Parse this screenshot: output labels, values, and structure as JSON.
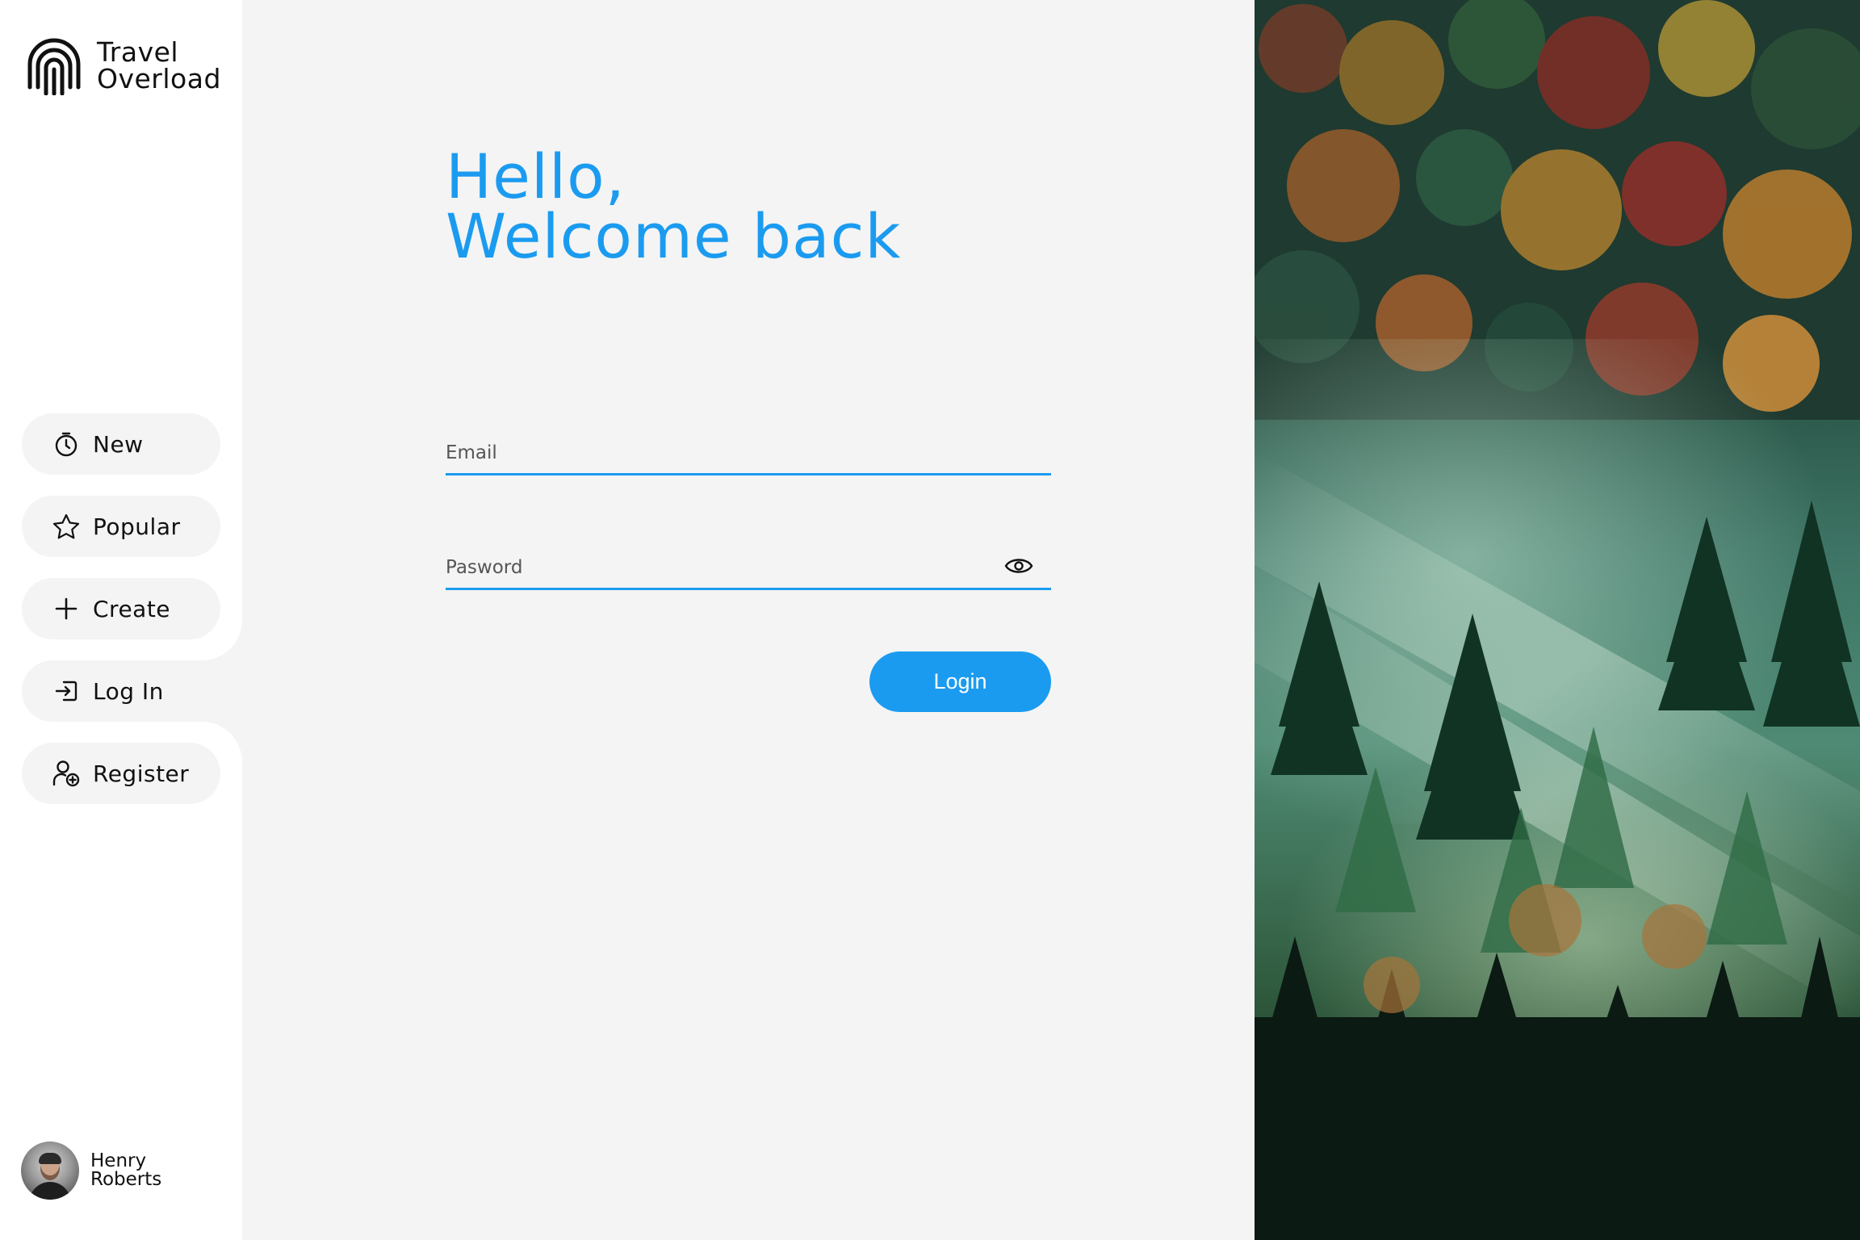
{
  "brand": {
    "line1": "Travel",
    "line2": "Overload",
    "icon": "fingerprint-arch-icon"
  },
  "nav": {
    "items": [
      {
        "label": "New",
        "icon": "timer-icon"
      },
      {
        "label": "Popular",
        "icon": "star-icon"
      },
      {
        "label": "Create",
        "icon": "plus-icon"
      },
      {
        "label": "Log In",
        "icon": "login-icon"
      },
      {
        "label": "Register",
        "icon": "user-add-icon"
      }
    ],
    "active": "Log In"
  },
  "user": {
    "first_name": "Henry",
    "last_name": "Roberts"
  },
  "greeting": {
    "line1": "Hello,",
    "line2": "Welcome back"
  },
  "form": {
    "email_placeholder": "Email",
    "password_placeholder": "Pasword",
    "login_label": "Login"
  },
  "colors": {
    "accent": "#1b9bf0",
    "background": "#f4f4f4",
    "sidebar": "#ffffff",
    "text": "#111111"
  }
}
